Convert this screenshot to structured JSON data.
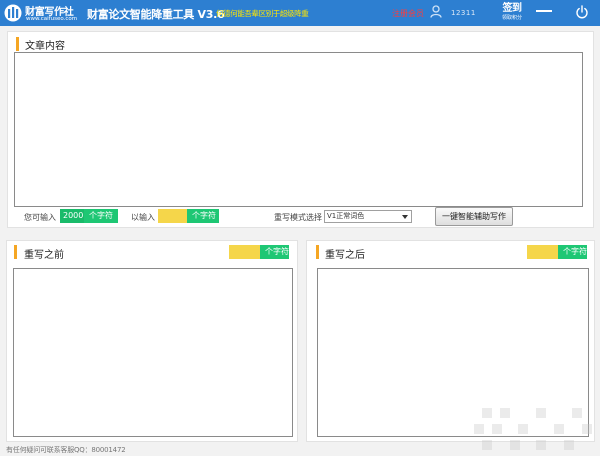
{
  "header": {
    "logo_text": "财富写作社",
    "logo_url": "www.caifuseo.com",
    "app_title": "财富论文智能降重工具 V3.6",
    "promo_text": "何德何能吾辈区别于超级降重",
    "register_label": "注册会员",
    "user_id": "12311",
    "signin_label": "签到",
    "signin_sub": "领取积分"
  },
  "article": {
    "title": "文章内容",
    "content": "",
    "allowed_label": "您可输入",
    "allowed_value": "2000",
    "allowed_unit": "个字符",
    "entered_label": "以输入",
    "entered_value": "",
    "entered_unit": "个字符",
    "mode_label": "重写模式选择",
    "mode_value": "V1正常词色",
    "assist_button": "一键智能辅助写作"
  },
  "before": {
    "title": "重写之前",
    "count_value": "",
    "count_unit": "个字符",
    "content": ""
  },
  "after": {
    "title": "重写之后",
    "count_value": "",
    "count_unit": "个字符",
    "content": ""
  },
  "footer": {
    "text": "有任何疑问可联系客服QQ：80001472"
  },
  "colors": {
    "header_bg": "#2d7fd1",
    "accent": "#f5a623",
    "count_green": "#1ec774",
    "count_yellow": "#f5d64a",
    "promo_yellow": "#ffe600",
    "register_red": "#ff3b3b"
  },
  "icons": [
    "logo-icon",
    "user-icon",
    "minimize-icon",
    "power-icon"
  ]
}
